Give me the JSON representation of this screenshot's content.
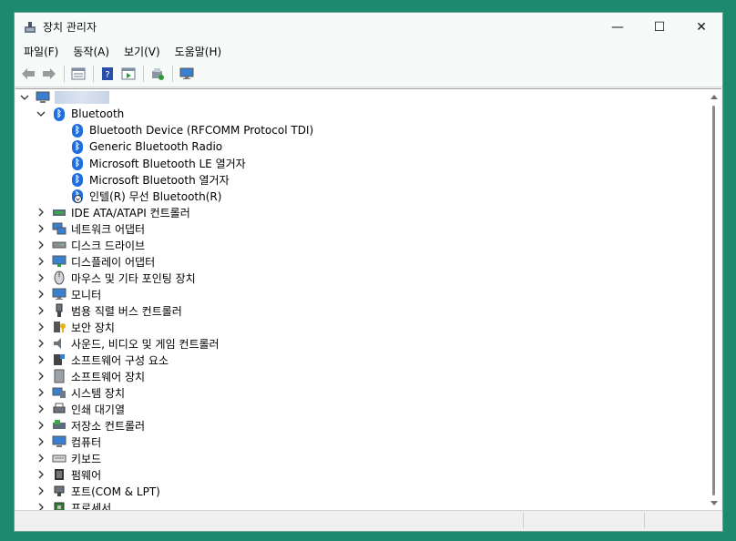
{
  "window": {
    "title": "장치 관리자",
    "minimize": "—",
    "maximize": "☐",
    "close": "✕"
  },
  "menu": [
    "파일(F)",
    "동작(A)",
    "보기(V)",
    "도움말(H)"
  ],
  "toolbar": [
    "back-icon",
    "forward-icon",
    "properties-icon",
    "help-icon",
    "run-icon",
    "update-driver-icon",
    "monitor-icon"
  ],
  "tree": {
    "root_expanded": true,
    "bluetooth": {
      "label": "Bluetooth",
      "children": [
        "Bluetooth Device (RFCOMM Protocol TDI)",
        "Generic Bluetooth Radio",
        "Microsoft Bluetooth LE 열거자",
        "Microsoft Bluetooth 열거자",
        "인텔(R) 무선 Bluetooth(R)"
      ]
    },
    "categories": [
      {
        "label": "IDE ATA/ATAPI 컨트롤러",
        "icon": "ide-controller-icon"
      },
      {
        "label": "네트워크 어댑터",
        "icon": "network-adapter-icon"
      },
      {
        "label": "디스크 드라이브",
        "icon": "disk-drive-icon"
      },
      {
        "label": "디스플레이 어댑터",
        "icon": "display-adapter-icon"
      },
      {
        "label": "마우스 및 기타 포인팅 장치",
        "icon": "mouse-icon"
      },
      {
        "label": "모니터",
        "icon": "monitor-icon"
      },
      {
        "label": "범용 직렬 버스 컨트롤러",
        "icon": "usb-icon"
      },
      {
        "label": "보안 장치",
        "icon": "security-device-icon"
      },
      {
        "label": "사운드, 비디오 및 게임 컨트롤러",
        "icon": "sound-icon"
      },
      {
        "label": "소프트웨어 구성 요소",
        "icon": "software-component-icon"
      },
      {
        "label": "소프트웨어 장치",
        "icon": "software-device-icon"
      },
      {
        "label": "시스템 장치",
        "icon": "system-device-icon"
      },
      {
        "label": "인쇄 대기열",
        "icon": "print-queue-icon"
      },
      {
        "label": "저장소 컨트롤러",
        "icon": "storage-controller-icon"
      },
      {
        "label": "컴퓨터",
        "icon": "computer-icon"
      },
      {
        "label": "키보드",
        "icon": "keyboard-icon"
      },
      {
        "label": "펌웨어",
        "icon": "firmware-icon"
      },
      {
        "label": "포트(COM & LPT)",
        "icon": "port-icon"
      },
      {
        "label": "프로세서",
        "icon": "processor-icon"
      }
    ]
  },
  "colors": {
    "desktop": "#1d8a70",
    "bluetooth": "#1e6ee0"
  }
}
